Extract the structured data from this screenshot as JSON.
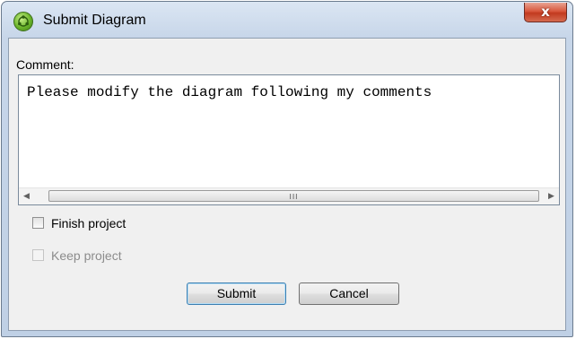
{
  "window": {
    "title": "Submit Diagram",
    "close_label": "x"
  },
  "form": {
    "comment_label": "Comment:",
    "comment_value": "Please modify the diagram following my comments",
    "scrollbar_grip": "III",
    "finish_project_label": "Finish project",
    "finish_project_checked": false,
    "keep_project_label": "Keep project",
    "keep_project_checked": false,
    "keep_project_enabled": false
  },
  "buttons": {
    "submit_label": "Submit",
    "cancel_label": "Cancel"
  }
}
